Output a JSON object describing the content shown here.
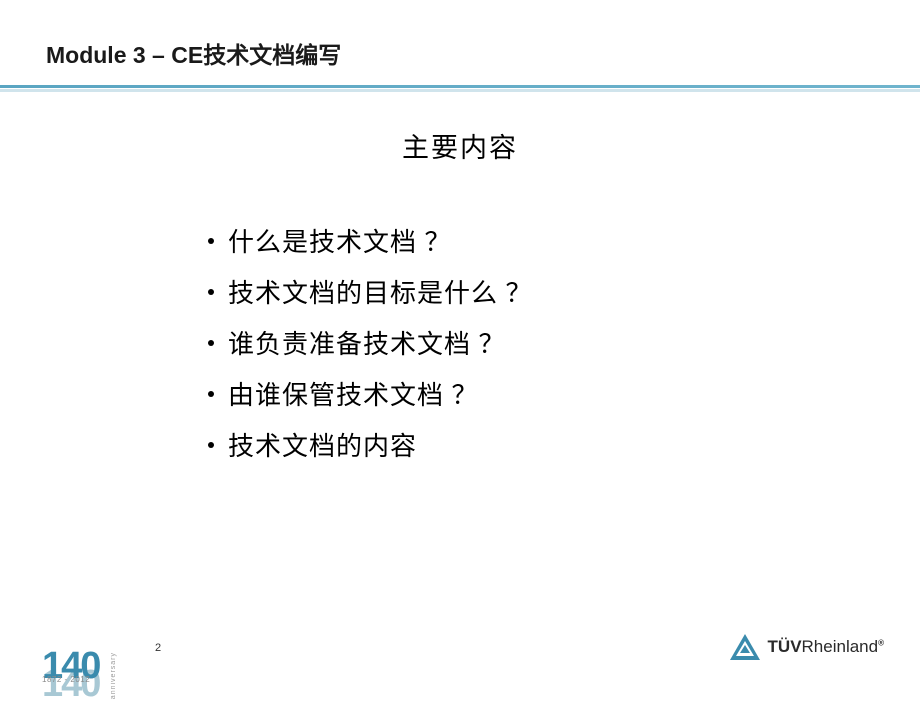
{
  "header": {
    "title": "Module 3 – CE技术文档编写"
  },
  "section": {
    "title": "主要内容"
  },
  "bullets": {
    "items": [
      {
        "text": "什么是技术文档 ？"
      },
      {
        "text": "技术文档的目标是什么 ？"
      },
      {
        "text": "谁负责准备技术文档 ？"
      },
      {
        "text": "由谁保管技术文档 ？"
      },
      {
        "text": "技术文档的内容"
      }
    ]
  },
  "footer": {
    "page_number": "2",
    "anniversary": {
      "number": "140",
      "years": "1872 - 2012",
      "label": "anniversary"
    },
    "brand": {
      "prefix": "TÜV",
      "suffix": "Rheinland",
      "reg": "®"
    }
  }
}
